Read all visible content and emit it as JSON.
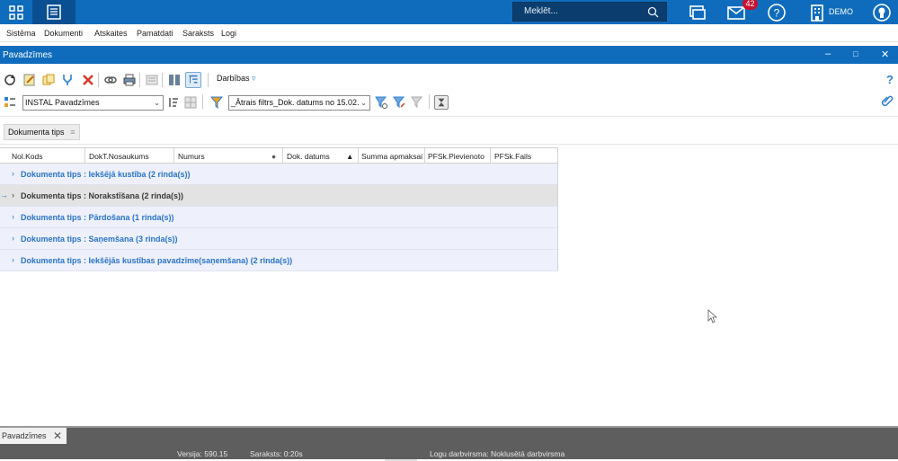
{
  "topbar": {
    "search_placeholder": "Meklēt...",
    "notification_count": "42",
    "company": "DEMO",
    "brand_color": "#0f6cbd"
  },
  "menu": [
    "Sistēma",
    "Dokumenti",
    "Atskaites",
    "Pamatdati",
    "Saraksts",
    "Logi"
  ],
  "window": {
    "title": "Pavadzīmes",
    "controls": [
      "–",
      "□",
      "✕"
    ]
  },
  "toolbar": {
    "actions_label": "Darbības",
    "layout_select": "INSTAL Pavadzīmes",
    "filter_select": "_Ātrais filtrs_Dok. datums no 15.02."
  },
  "grouping": {
    "chip_label": "Dokumenta tips"
  },
  "grid": {
    "columns": [
      "Nol.Kods",
      "DokT.Nosaukums",
      "Numurs",
      "Dok. datums",
      "Summa apmaksai",
      "PFSk.Pievienoto",
      "PFSk.Fails"
    ],
    "groups": [
      {
        "label": "Dokumenta tips : Iekšējā kustība (2 rinda(s))",
        "selected": false
      },
      {
        "label": "Dokumenta tips : Norakstīšana (2 rinda(s))",
        "selected": true
      },
      {
        "label": "Dokumenta tips : Pārdošana (1 rinda(s))",
        "selected": false
      },
      {
        "label": "Dokumenta tips : Saņemšana (3 rinda(s))",
        "selected": false
      },
      {
        "label": "Dokumenta tips : Iekšējās kustības pavadzīme(saņemšana) (2 rinda(s))",
        "selected": false
      }
    ]
  },
  "status": {
    "tab": "Pavadzīmes",
    "version": "Versija: 590.15",
    "list_time": "Saraksts: 0:20s",
    "log_mode": "Logu darbvirsma: Noklusētā darbvirsma"
  }
}
